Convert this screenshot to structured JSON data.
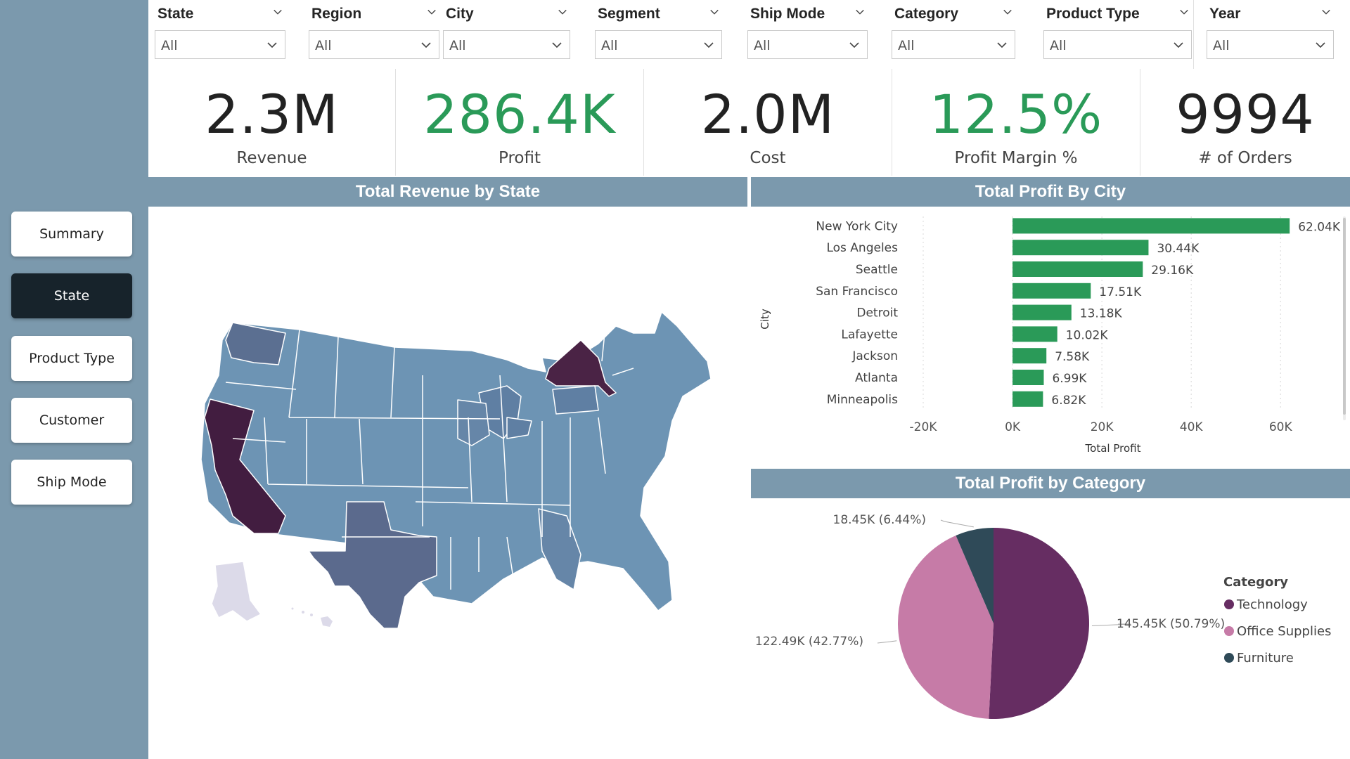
{
  "sidebar": {
    "items": [
      {
        "label": "Summary",
        "active": false
      },
      {
        "label": "State",
        "active": true
      },
      {
        "label": "Product Type",
        "active": false
      },
      {
        "label": "Customer",
        "active": false
      },
      {
        "label": "Ship Mode",
        "active": false
      }
    ]
  },
  "slicers": [
    {
      "title": "State",
      "value": "All"
    },
    {
      "title": "Region",
      "value": "All"
    },
    {
      "title": "City",
      "value": "All"
    },
    {
      "title": "Segment",
      "value": "All"
    },
    {
      "title": "Ship Mode",
      "value": "All"
    },
    {
      "title": "Category",
      "value": "All"
    },
    {
      "title": "Product Type",
      "value": "All"
    },
    {
      "title": "Year",
      "value": "All"
    }
  ],
  "kpis": [
    {
      "value": "2.3M",
      "label": "Revenue"
    },
    {
      "value": "286.4K",
      "label": "Profit"
    },
    {
      "value": "2.0M",
      "label": "Cost"
    },
    {
      "value": "12.5%",
      "label": "Profit Margin %"
    },
    {
      "value": "9994",
      "label": "# of Orders"
    }
  ],
  "sections": {
    "map_title": "Total Revenue by State",
    "bar_title": "Total Profit By City",
    "pie_title": "Total Profit by Category"
  },
  "colors": {
    "sidebar": "#7b99ad",
    "active_nav": "#17232b",
    "green": "#2a9a58",
    "technology": "#662d62",
    "office_supplies": "#c67ba7",
    "furniture": "#2f4a58"
  },
  "chart_data": [
    {
      "type": "bar",
      "orientation": "horizontal",
      "title": "Total Profit By City",
      "xlabel": "Total Profit",
      "ylabel": "City",
      "categories": [
        "New York City",
        "Los Angeles",
        "Seattle",
        "San Francisco",
        "Detroit",
        "Lafayette",
        "Jackson",
        "Atlanta",
        "Minneapolis"
      ],
      "values": [
        62040,
        30440,
        29160,
        17510,
        13180,
        10020,
        7580,
        6990,
        6820
      ],
      "data_labels": [
        "62.04K",
        "30.44K",
        "29.16K",
        "17.51K",
        "13.18K",
        "10.02K",
        "7.58K",
        "6.99K",
        "6.82K"
      ],
      "xlim": [
        -20000,
        65000
      ],
      "xticks": [
        -20000,
        0,
        20000,
        40000,
        60000
      ],
      "xtick_labels": [
        "-20K",
        "0K",
        "20K",
        "40K",
        "60K"
      ],
      "color": "#2a9a58",
      "grid": true
    },
    {
      "type": "pie",
      "title": "Total Profit by Category",
      "legend_title": "Category",
      "legend_position": "right",
      "slices": [
        {
          "name": "Technology",
          "value": 145450,
          "label": "145.45K (50.79%)",
          "color": "#662d62"
        },
        {
          "name": "Office Supplies",
          "value": 122490,
          "label": "122.49K (42.77%)",
          "color": "#c67ba7"
        },
        {
          "name": "Furniture",
          "value": 18450,
          "label": "18.45K (6.44%)",
          "color": "#2f4a58"
        }
      ]
    }
  ]
}
